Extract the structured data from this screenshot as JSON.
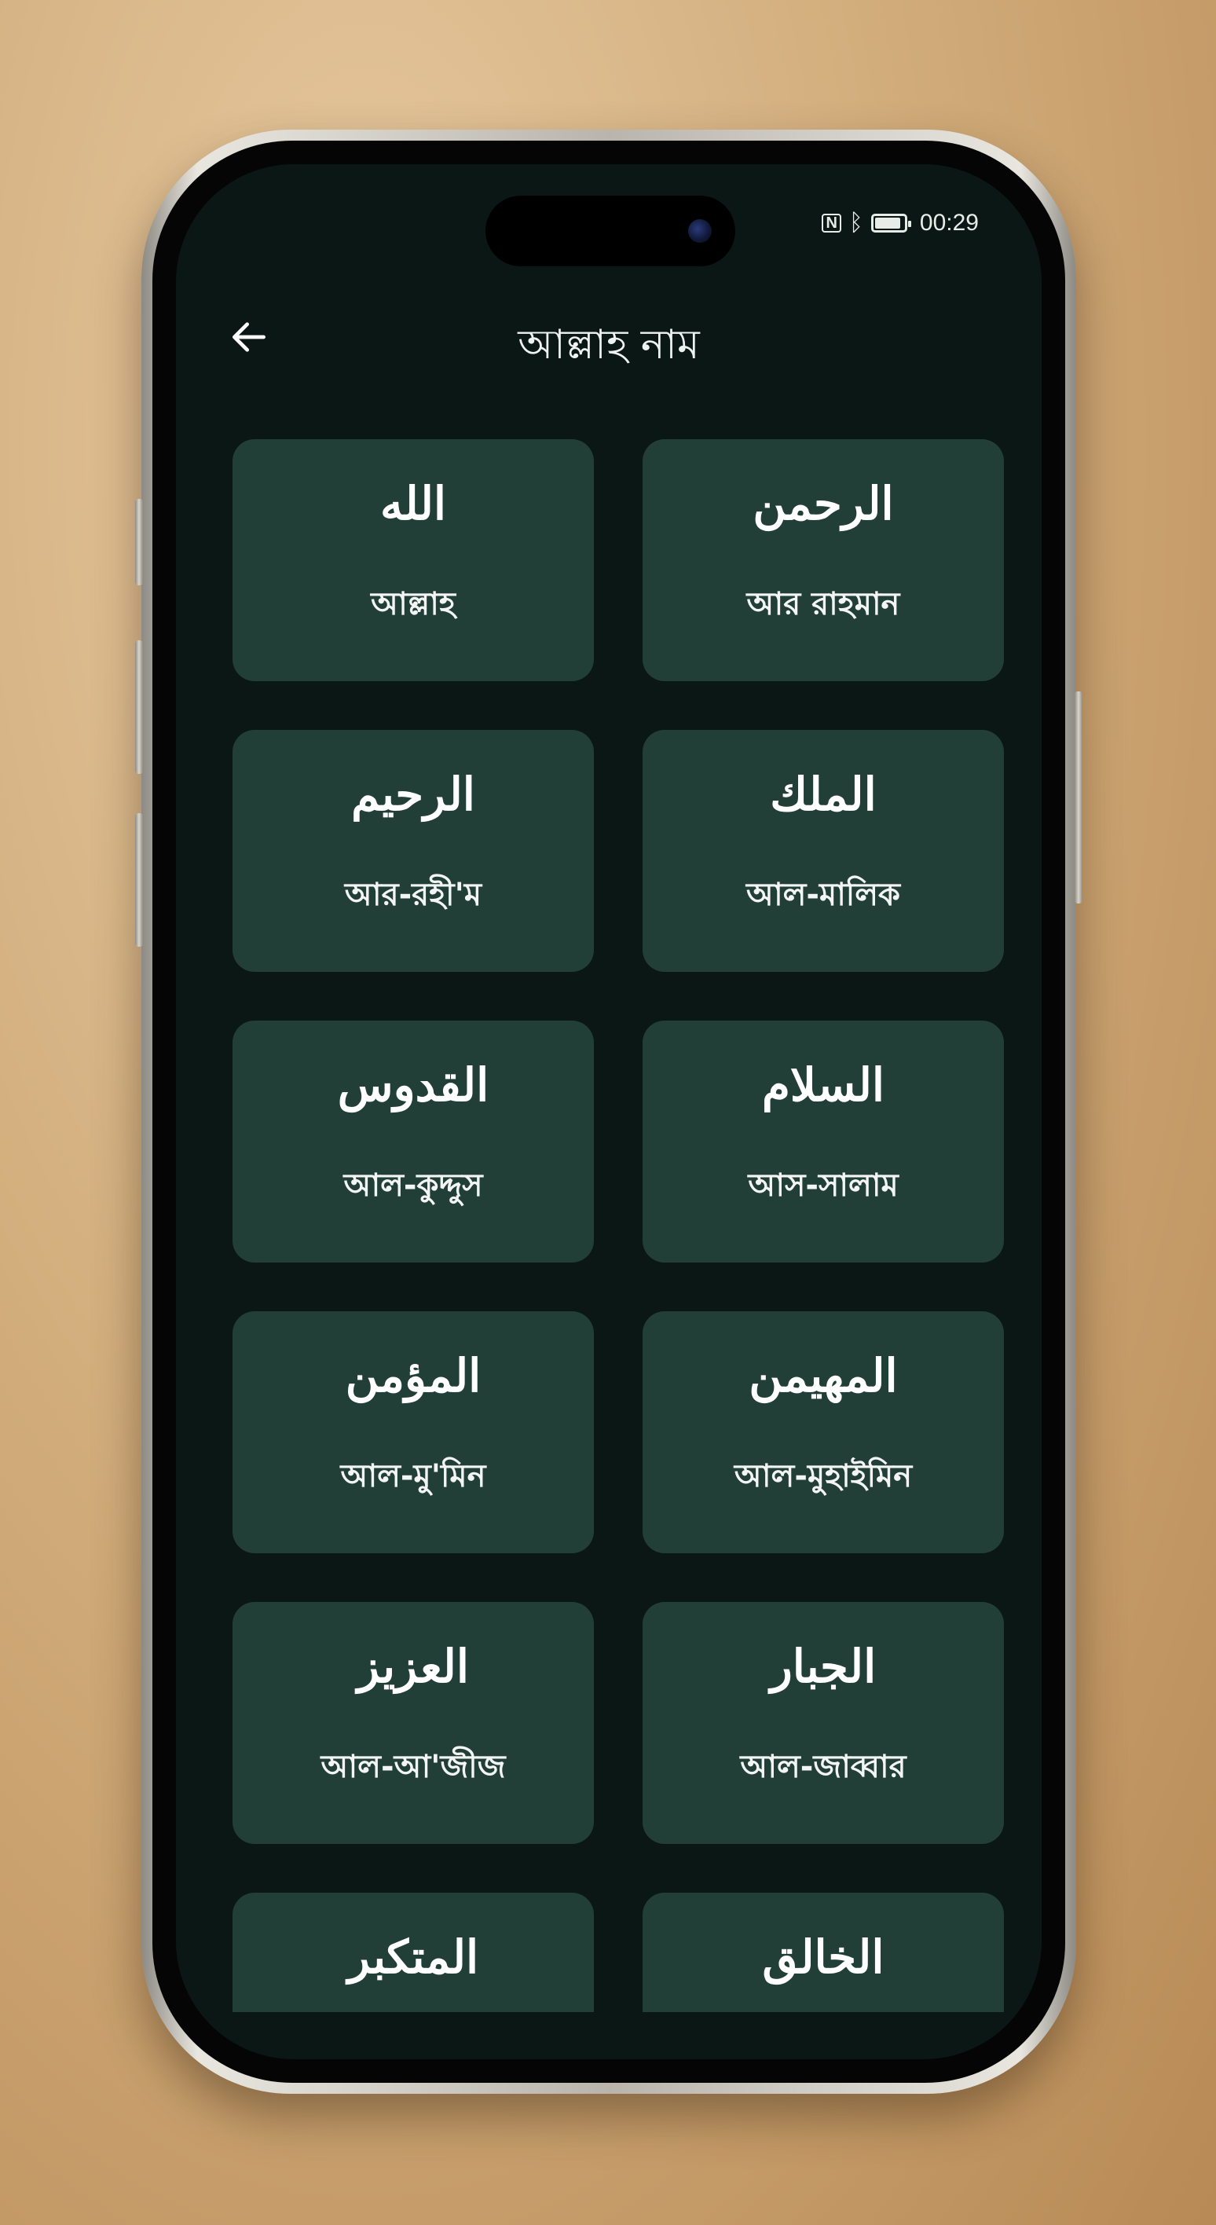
{
  "status_bar": {
    "icons": [
      "nfc-icon",
      "bluetooth-icon",
      "battery-icon"
    ],
    "nfc_glyph": "N",
    "bluetooth_glyph": "ᛒ",
    "battery_level": 0.9,
    "time": "00:29"
  },
  "header": {
    "back_icon": "arrow-left-icon",
    "title": "আল্লাহ নাম"
  },
  "colors": {
    "background": "#0b1714",
    "card": "#223f37",
    "text": "#ffffff"
  },
  "names": [
    {
      "arabic": "الله",
      "bangla": "আল্লাহ"
    },
    {
      "arabic": "الرحمن",
      "bangla": "আর রাহমান"
    },
    {
      "arabic": "الرحيم",
      "bangla": "আর-রহী'ম"
    },
    {
      "arabic": "الملك",
      "bangla": "আল-মালিক"
    },
    {
      "arabic": "القدوس",
      "bangla": "আল-কুদ্দুস"
    },
    {
      "arabic": "السلام",
      "bangla": "আস-সালাম"
    },
    {
      "arabic": "المؤمن",
      "bangla": "আল-মু'মিন"
    },
    {
      "arabic": "المهيمن",
      "bangla": "আল-মুহাইমিন"
    },
    {
      "arabic": "العزيز",
      "bangla": "আল-আ'জীজ"
    },
    {
      "arabic": "الجبار",
      "bangla": "আল-জাব্বার"
    },
    {
      "arabic": "المتكبر",
      "bangla": ""
    },
    {
      "arabic": "الخالق",
      "bangla": ""
    }
  ]
}
